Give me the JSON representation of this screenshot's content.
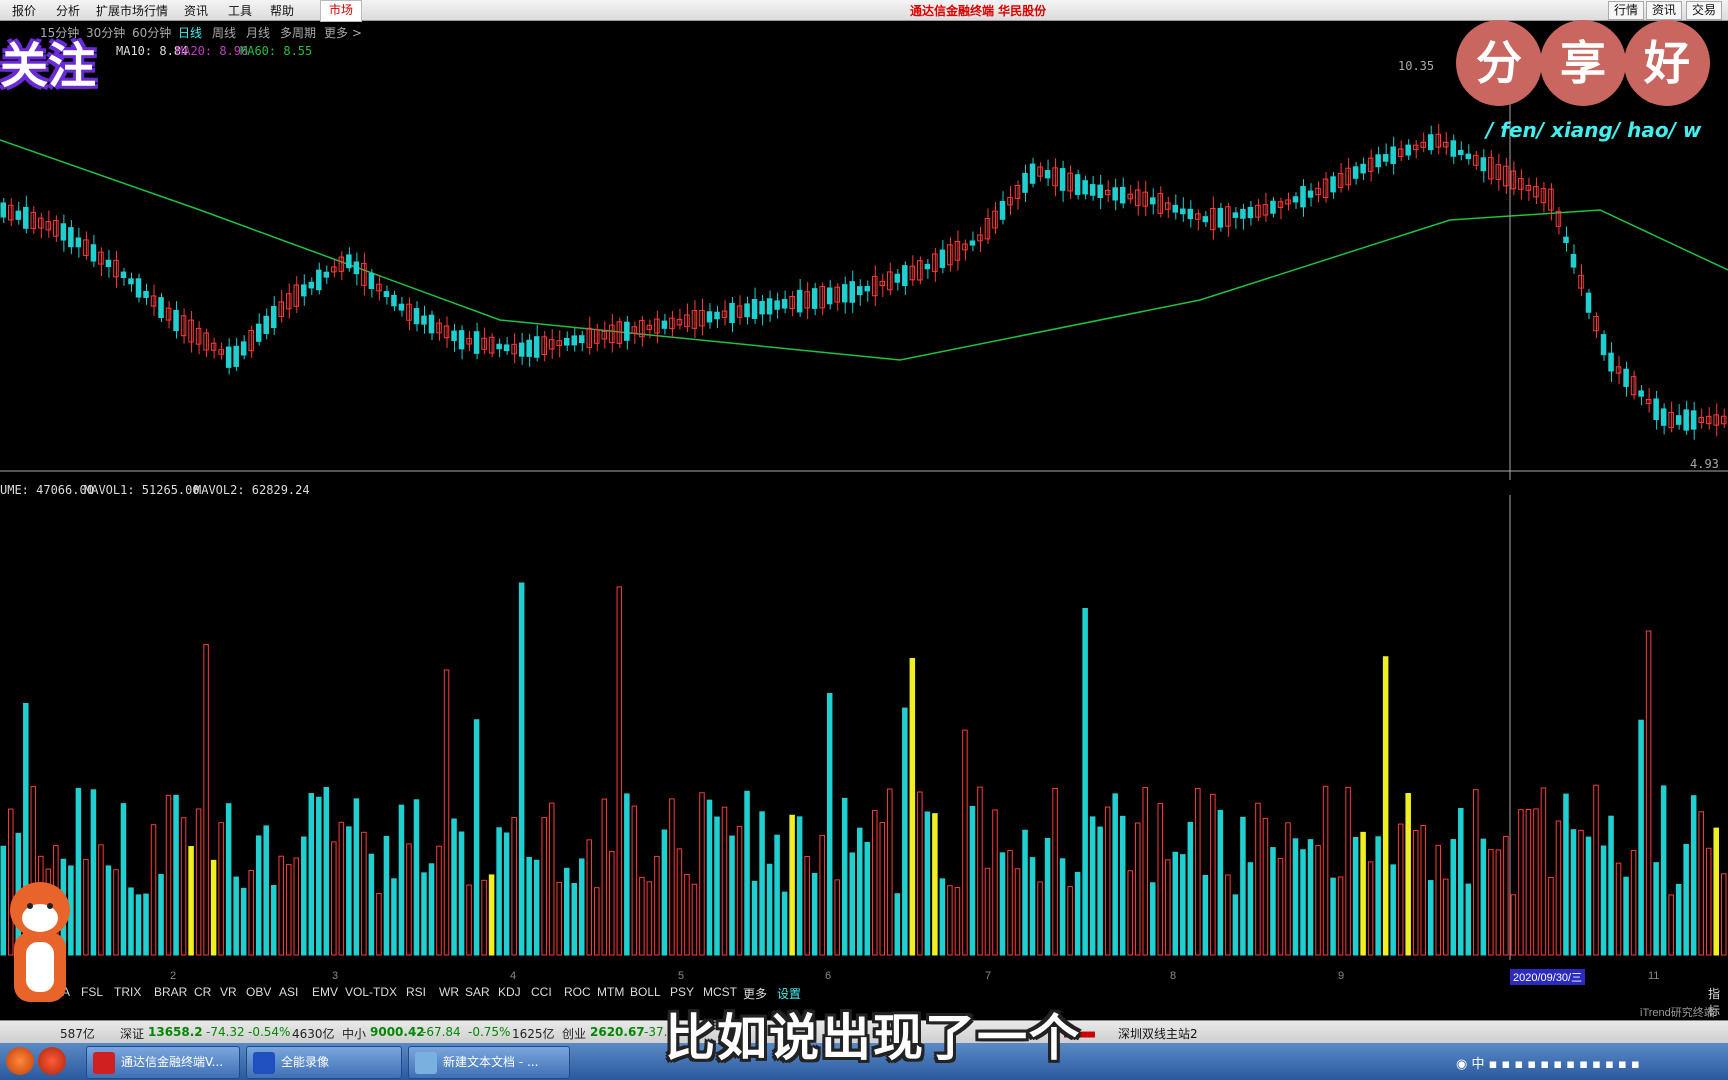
{
  "menu": {
    "items": [
      "报价",
      "分析",
      "扩展市场行情",
      "资讯",
      "工具",
      "帮助"
    ],
    "market_btn": "市场",
    "title": "通达信金融终端  华民股份",
    "right_buttons": [
      "行情",
      "资讯",
      "交易"
    ]
  },
  "period_bar": {
    "items": [
      "15分钟",
      "30分钟",
      "60分钟",
      "日线",
      "周线",
      "月线",
      "多周期",
      "更多 >"
    ],
    "active_index": 3
  },
  "ma_line": {
    "ma10": "MA10: 8.84",
    "ma20": "MA20: 8.96",
    "ma60": "MA60: 8.55",
    "colors": {
      "ma10": "#dddddd",
      "ma20": "#c040c0",
      "ma60": "#20c040"
    }
  },
  "price_chart": {
    "high_label": "10.35",
    "low_label": "4.93"
  },
  "volume_header": {
    "volume": "UME: 47066.00",
    "mavol1": "MAVOL1: 51265.00",
    "mavol2": "MAVOL2: 62829.24"
  },
  "x_axis_labels": [
    "2",
    "3",
    "4",
    "5",
    "6",
    "7",
    "8",
    "9",
    "11"
  ],
  "cursor_date": "2020/09/30/三",
  "indicator_tabs": [
    "A",
    "FSL",
    "TRIX",
    "BRAR",
    "CR",
    "VR",
    "OBV",
    "ASI",
    "EMV",
    "VOL-TDX",
    "RSI",
    "WR",
    "SAR",
    "KDJ",
    "CCI",
    "ROC",
    "MTM",
    "BOLL",
    "PSY",
    "MCST",
    "更多",
    "设置"
  ],
  "right_bottom_text": "iTrend研究终端",
  "right_label": "指标",
  "status": {
    "sh_amount": "587亿",
    "sz_name": "深证",
    "sz_value": "13658.2",
    "sz_change": "-74.32",
    "sz_pct": "-0.54%",
    "sz_amount": "4630亿",
    "zx_name": "中小",
    "zx_value": "9000.42",
    "zx_change": "-67.84",
    "zx_pct": "-0.75%",
    "zx_amount": "1625亿",
    "cy_name": "创业",
    "cy_value": "2620.67",
    "cy_change": "-37.4",
    "server": "深圳双线主站2"
  },
  "taskbar": {
    "tasks": [
      "通达信金融终端V...",
      "全能录像",
      "新建文本文档 - ..."
    ]
  },
  "overlays": {
    "subtitle": "比如说出现了一个",
    "share_chars": [
      "分",
      "享",
      "好"
    ],
    "share_pinyin": "/ fen/ xiang/ hao/ w",
    "follow_text": "关注"
  },
  "colors": {
    "up": "#ff3a3a",
    "down": "#20d0d0",
    "highlight": "#f0f020",
    "background": "#000000"
  },
  "chart_data": {
    "type": "candlestick",
    "title": "",
    "y_range": [
      4.93,
      10.35
    ],
    "series": []
  }
}
